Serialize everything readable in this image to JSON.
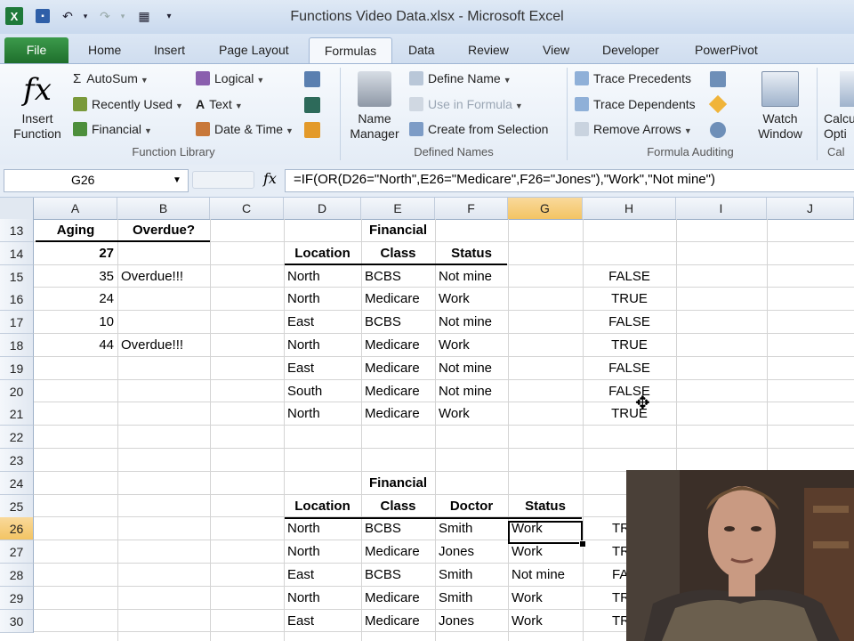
{
  "window": {
    "title": "Functions Video Data.xlsx - Microsoft Excel"
  },
  "tabs": [
    "File",
    "Home",
    "Insert",
    "Page Layout",
    "Formulas",
    "Data",
    "Review",
    "View",
    "Developer",
    "PowerPivot"
  ],
  "ribbon": {
    "insert_function": {
      "line1": "Insert",
      "line2": "Function"
    },
    "library": {
      "autosum": "AutoSum",
      "recently_used": "Recently Used",
      "financial": "Financial",
      "logical": "Logical",
      "text": "Text",
      "date_time": "Date & Time",
      "group_label": "Function Library"
    },
    "names": {
      "name_manager_1": "Name",
      "name_manager_2": "Manager",
      "define_name": "Define Name",
      "use_in_formula": "Use in Formula",
      "create_from_selection": "Create from Selection",
      "group_label": "Defined Names"
    },
    "auditing": {
      "trace_precedents": "Trace Precedents",
      "trace_dependents": "Trace Dependents",
      "remove_arrows": "Remove Arrows",
      "watch_1": "Watch",
      "watch_2": "Window",
      "group_label": "Formula Auditing"
    },
    "calc": {
      "line1": "Calcu",
      "line2": "Opti",
      "group_label": "Cal"
    }
  },
  "formula_bar": {
    "name_box": "G26",
    "fx": "fx",
    "formula": "=IF(OR(D26=\"North\",E26=\"Medicare\",F26=\"Jones\"),\"Work\",\"Not mine\")"
  },
  "columns": [
    "A",
    "B",
    "C",
    "D",
    "E",
    "F",
    "G",
    "H",
    "I",
    "J"
  ],
  "rows": [
    "13",
    "14",
    "15",
    "16",
    "17",
    "18",
    "19",
    "20",
    "21",
    "22",
    "23",
    "24",
    "25",
    "26",
    "27",
    "28",
    "29",
    "30"
  ],
  "cells": {
    "A13": "Aging",
    "B13": "Overdue?",
    "A14": "27",
    "A15": "35",
    "B15": "Overdue!!!",
    "A16": "24",
    "A17": "10",
    "A18": "44",
    "B18": "Overdue!!!",
    "E13": "Financial",
    "D14": "Location",
    "E14": "Class",
    "F14": "Status",
    "D15": "North",
    "E15": "BCBS",
    "F15": "Not mine",
    "H15": "FALSE",
    "D16": "North",
    "E16": "Medicare",
    "F16": "Work",
    "H16": "TRUE",
    "D17": "East",
    "E17": "BCBS",
    "F17": "Not mine",
    "H17": "FALSE",
    "D18": "North",
    "E18": "Medicare",
    "F18": "Work",
    "H18": "TRUE",
    "D19": "East",
    "E19": "Medicare",
    "F19": "Not mine",
    "H19": "FALSE",
    "D20": "South",
    "E20": "Medicare",
    "F20": "Not mine",
    "H20": "FALSE",
    "D21": "North",
    "E21": "Medicare",
    "F21": "Work",
    "H21": "TRUE",
    "E24": "Financial",
    "D25": "Location",
    "E25": "Class",
    "F25": "Doctor",
    "G25": "Status",
    "D26": "North",
    "E26": "BCBS",
    "F26": "Smith",
    "G26": "Work",
    "H26": "TR",
    "D27": "North",
    "E27": "Medicare",
    "F27": "Jones",
    "G27": "Work",
    "H27": "TR",
    "D28": "East",
    "E28": "BCBS",
    "F28": "Smith",
    "G28": "Not mine",
    "H28": "FA",
    "D29": "North",
    "E29": "Medicare",
    "F29": "Smith",
    "G29": "Work",
    "H29": "TR",
    "D30": "East",
    "E30": "Medicare",
    "F30": "Jones",
    "G30": "Work",
    "H30": "TR"
  },
  "selection": {
    "active_cell": "G26",
    "selected_column": "G",
    "selected_row": "26"
  }
}
